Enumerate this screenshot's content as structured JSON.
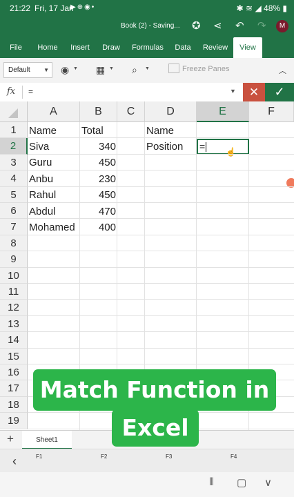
{
  "status_bar": {
    "time": "21:22",
    "date": "Fri, 17 Jan",
    "battery": "48%"
  },
  "title_bar": {
    "document": "Book (2) - Saving...",
    "avatar_initial": "M"
  },
  "ribbon_tabs": [
    "File",
    "Home",
    "Insert",
    "Draw",
    "Formulas",
    "Data",
    "Review",
    "View"
  ],
  "active_tab": "View",
  "toolbar": {
    "view_select": "Default",
    "freeze_panes": "Freeze Panes"
  },
  "formula_bar": {
    "fx": "fx",
    "content": "="
  },
  "columns": [
    "A",
    "B",
    "C",
    "D",
    "E",
    "F"
  ],
  "selected_column": "E",
  "rows": [
    "1",
    "2",
    "3",
    "4",
    "5",
    "6",
    "7",
    "8",
    "9",
    "10",
    "11",
    "12",
    "13",
    "14",
    "15",
    "16",
    "17",
    "18",
    "19"
  ],
  "selected_row": "2",
  "cells": {
    "A1": "Name",
    "B1": "Total",
    "D1": "Name",
    "D2": "Position",
    "A2": "Siva",
    "B2": "340",
    "A3": "Guru",
    "B3": "450",
    "A4": "Anbu",
    "B4": "230",
    "A5": "Rahul",
    "B5": "450",
    "A6": "Abdul",
    "B6": "470",
    "A7": "Mohamed",
    "B7": "400"
  },
  "active_cell": {
    "ref": "E2",
    "editing_text": "="
  },
  "sheet_tab": "Sheet1",
  "function_keys": [
    "F1",
    "F2",
    "F3",
    "F4"
  ],
  "overlay": {
    "line1": "Match Function in",
    "line2": "Excel"
  },
  "colors": {
    "excel_green": "#217346",
    "overlay_green": "#2cb54a",
    "cancel_red": "#c9513f"
  }
}
